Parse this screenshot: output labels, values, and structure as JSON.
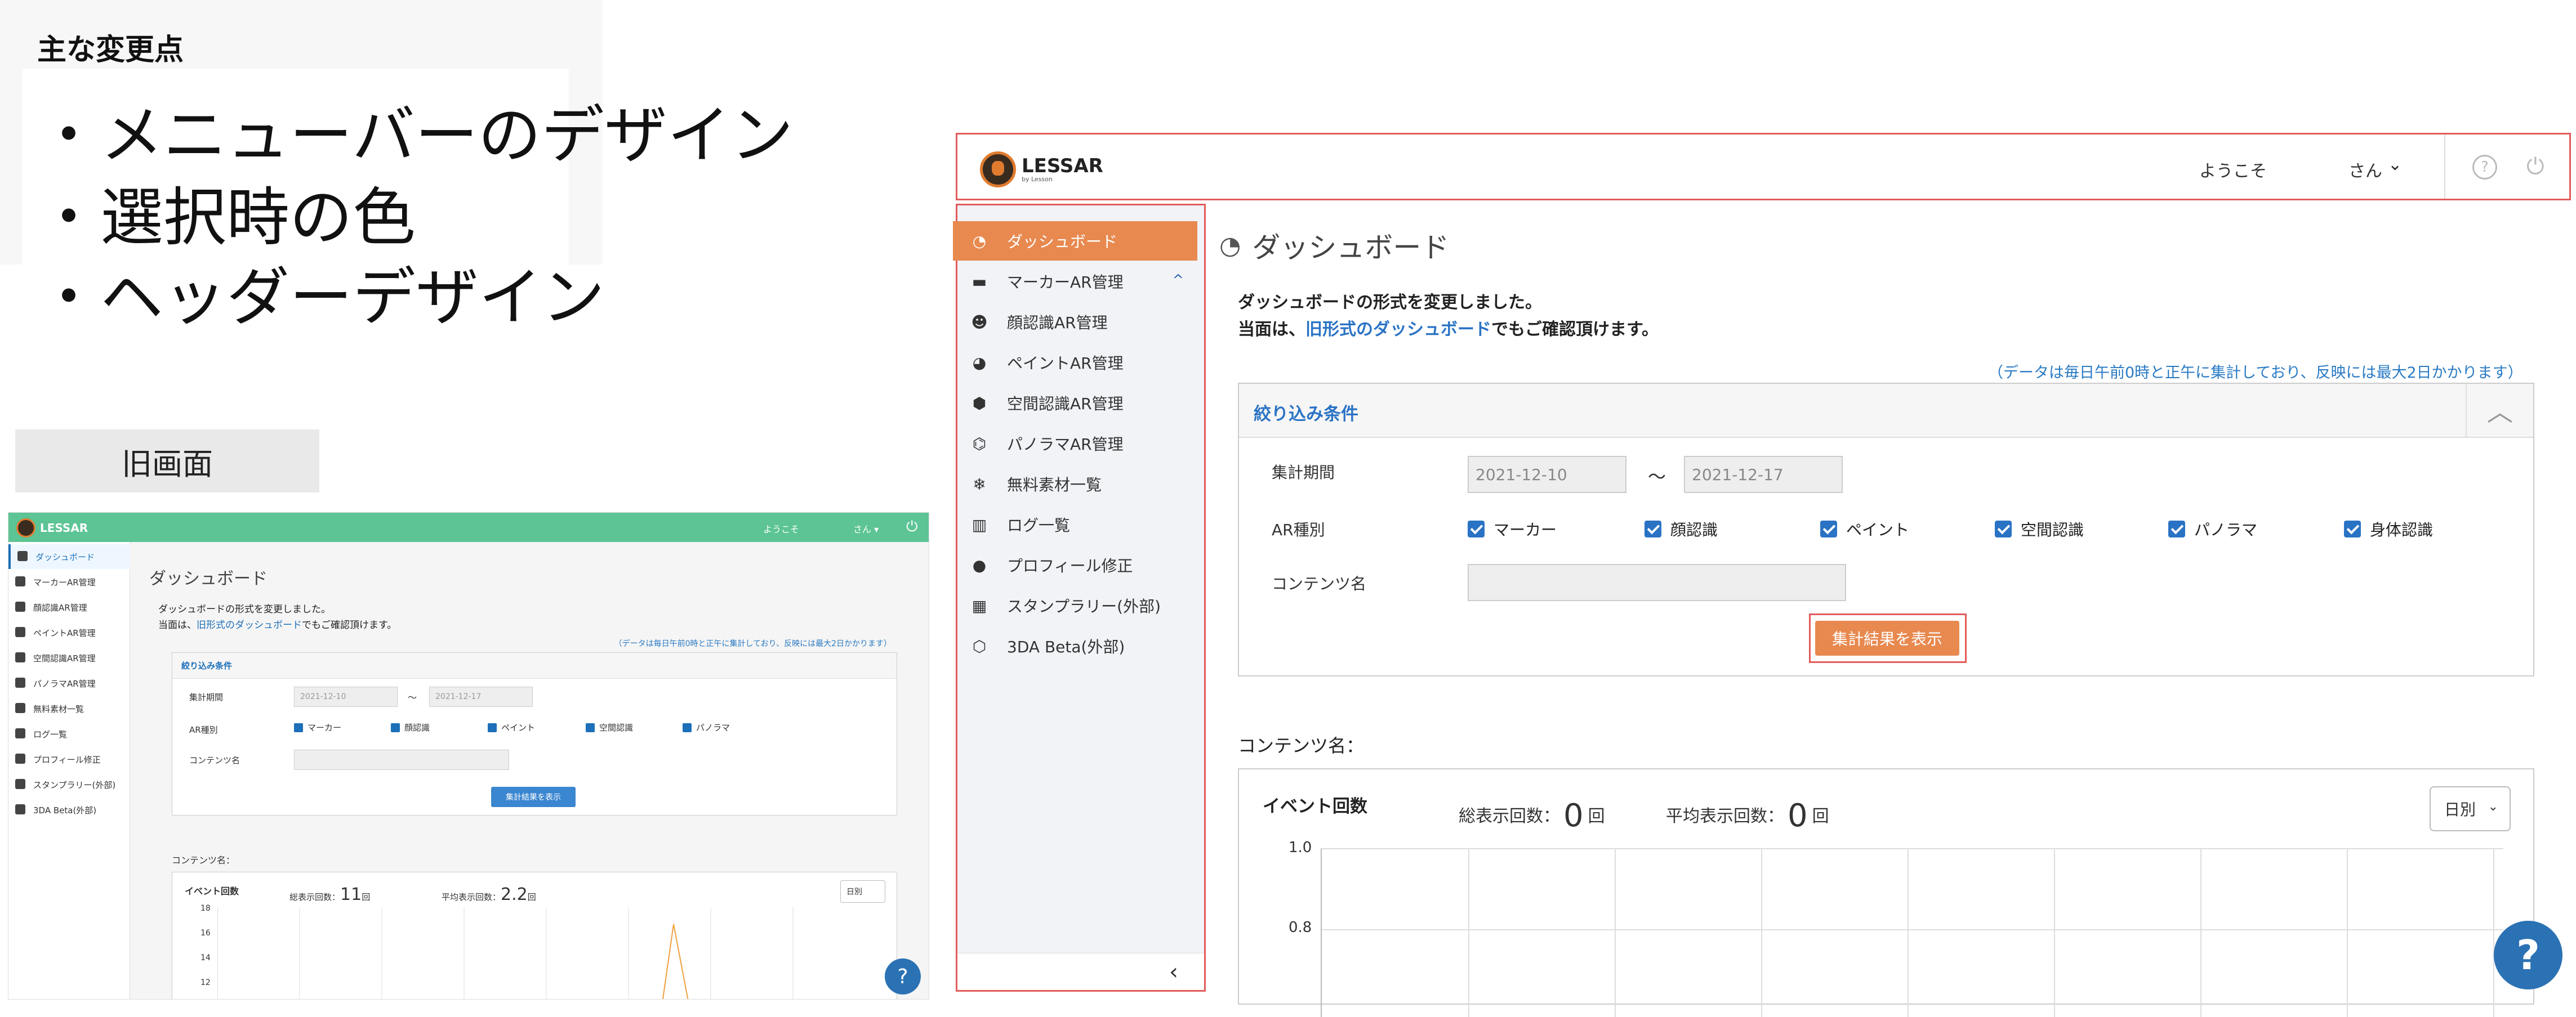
{
  "notes": {
    "title": "主な変更点",
    "items": [
      "・メニューバーのデザイン",
      "・選択時の色",
      "・ヘッダーデザイン"
    ],
    "old_label": "旧画面"
  },
  "old_screen": {
    "brand": "LESSAR",
    "welcome": "ようこそ",
    "san": "さん ▾",
    "sidebar": [
      "ダッシュボード",
      "マーカーAR管理",
      "顔認識AR管理",
      "ペイントAR管理",
      "空間認識AR管理",
      "パノラマAR管理",
      "無料素材一覧",
      "ログ一覧",
      "プロフィール修正",
      "スタンプラリー(外部)",
      "3DA Beta(外部)"
    ],
    "title": "ダッシュボード",
    "msg_line1": "ダッシュボードの形式を変更しました。",
    "msg_line2_pre": "当面は、",
    "msg_line2_link": "旧形式のダッシュボード",
    "msg_line2_post": "でもご確認頂けます。",
    "note": "（データは毎日午前0時と正午に集計しており、反映には最大2日かかります）",
    "filter_title": "絞り込み条件",
    "period_label": "集計期間",
    "date_from": "2021-12-10",
    "tilde": "〜",
    "date_to": "2021-12-17",
    "ar_label": "AR種別",
    "ar_types": [
      "マーカー",
      "顔認識",
      "ペイント",
      "空間認識",
      "パノラマ"
    ],
    "content_label": "コンテンツ名",
    "button": "集計結果を表示",
    "content_name": "コンテンツ名：",
    "event_title": "イベント回数",
    "total_label": "総表示回数：",
    "total_value": "11",
    "avg_label": "平均表示回数：",
    "avg_value": "2.2",
    "unit": "回",
    "period_select": "日別",
    "yticks": [
      "18",
      "16",
      "14",
      "12"
    ],
    "help": "?"
  },
  "new_screen": {
    "brand": "LESSAR",
    "brand_sub": "by Lesson",
    "welcome": "ようこそ",
    "san": "さん",
    "help": "?",
    "sidebar": [
      {
        "label": "ダッシュボード",
        "icon": "gauge",
        "glyph": "◔",
        "active": true
      },
      {
        "label": "マーカーAR管理",
        "icon": "archive",
        "glyph": "▬",
        "caret": "^"
      },
      {
        "label": "顔認識AR管理",
        "icon": "smile",
        "glyph": "☻"
      },
      {
        "label": "ペイントAR管理",
        "icon": "palette",
        "glyph": "◕"
      },
      {
        "label": "空間認識AR管理",
        "icon": "cube",
        "glyph": "⬢"
      },
      {
        "label": "パノラマAR管理",
        "icon": "binoculars",
        "glyph": "⌬"
      },
      {
        "label": "無料素材一覧",
        "icon": "snowflake",
        "glyph": "❄"
      },
      {
        "label": "ログ一覧",
        "icon": "chart",
        "glyph": "▥"
      },
      {
        "label": "プロフィール修正",
        "icon": "user",
        "glyph": "●"
      },
      {
        "label": "スタンプラリー(外部)",
        "icon": "map",
        "glyph": "▦"
      },
      {
        "label": "3DA Beta(外部)",
        "icon": "cubes",
        "glyph": "⬡"
      }
    ],
    "collapse": "‹",
    "title": "ダッシュボード",
    "msg_line1": "ダッシュボードの形式を変更しました。",
    "msg_line2_pre": "当面は、",
    "msg_line2_link": "旧形式のダッシュボード",
    "msg_line2_post": "でもご確認頂けます。",
    "note": "（データは毎日午前0時と正午に集計しており、反映には最大2日かかります）",
    "filter_title": "絞り込み条件",
    "period_label": "集計期間",
    "date_from": "2021-12-10",
    "tilde": "〜",
    "date_to": "2021-12-17",
    "ar_label": "AR種別",
    "ar_types": [
      "マーカー",
      "顔認識",
      "ペイント",
      "空間認識",
      "パノラマ",
      "身体認識"
    ],
    "content_label": "コンテンツ名",
    "button": "集計結果を表示",
    "content_name": "コンテンツ名：",
    "event_title": "イベント回数",
    "total_label": "総表示回数：",
    "total_value": "0",
    "avg_label": "平均表示回数：",
    "avg_value": "0",
    "unit": "回",
    "period_select": "日別",
    "yticks": [
      "1.0",
      "0.8"
    ],
    "fab": "?"
  },
  "colors": {
    "accent_orange": "#e8894f",
    "link_blue": "#2a73c4",
    "highlight_red": "#e45b5b",
    "old_header_green": "#5cc495"
  }
}
